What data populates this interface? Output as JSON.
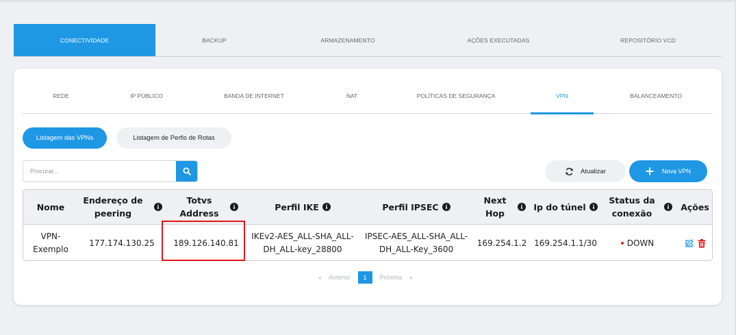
{
  "main_tabs": [
    {
      "label": "CONECTIVIDADE",
      "active": true
    },
    {
      "label": "BACKUP",
      "active": false
    },
    {
      "label": "ARMAZENAMENTO",
      "active": false
    },
    {
      "label": "AÇÕES EXECUTADAS",
      "active": false
    },
    {
      "label": "REPOSITÓRIO VCD",
      "active": false
    }
  ],
  "sub_tabs": [
    {
      "label": "REDE"
    },
    {
      "label": "IP PÚBLICO"
    },
    {
      "label": "BANDA DE INTERNET"
    },
    {
      "label": "NAT"
    },
    {
      "label": "POLÍTICAS DE SEGURANÇA"
    },
    {
      "label": "VPN",
      "active": true
    },
    {
      "label": "BALANCEAMENTO"
    }
  ],
  "list_buttons": {
    "vpn_list": "Listagem das VPNs",
    "route_profiles": "Listagem de Perfis de Rotas"
  },
  "search": {
    "placeholder": "Procurar...",
    "icon": "search-icon"
  },
  "actions": {
    "refresh_label": "Atualizar",
    "new_label": "Nova VPN"
  },
  "table": {
    "headers": {
      "nome": "Nome",
      "endereco_1": "Endereço de",
      "endereco_2": "peering",
      "totvs_1": "Totvs",
      "totvs_2": "Address",
      "perfil_ike": "Perfil IKE",
      "perfil_ipsec": "Perfil IPSEC",
      "next_1": "Next",
      "next_2": "Hop",
      "ip_tunel": "Ip do túnel",
      "status_1": "Status da",
      "status_2": "conexão",
      "acoes": "Ações"
    },
    "rows": [
      {
        "nome_1": "VPN-",
        "nome_2": "Exemplo",
        "endereco": "177.174.130.25",
        "totvs": "189.126.140.81",
        "ike_1": "IKEv2-AES_ALL-SHA_ALL-",
        "ike_2": "DH_ALL-key_28800",
        "ipsec_1": "IPSEC-AES_ALL-SHA_ALL-",
        "ipsec_2": "DH_ALL-Key_3600",
        "next_hop": "169.254.1.2",
        "ip_tunel": "169.254.1.1/30",
        "status": "DOWN"
      }
    ]
  },
  "pagination": {
    "prev_arrow": "«",
    "prev": "Anterior",
    "current": "1",
    "next": "Próxima",
    "next_arrow": "»"
  },
  "colors": {
    "primary": "#1e97e5",
    "status_down": "#d61f1f",
    "delete_icon": "#e01616",
    "highlight": "#e01616"
  }
}
